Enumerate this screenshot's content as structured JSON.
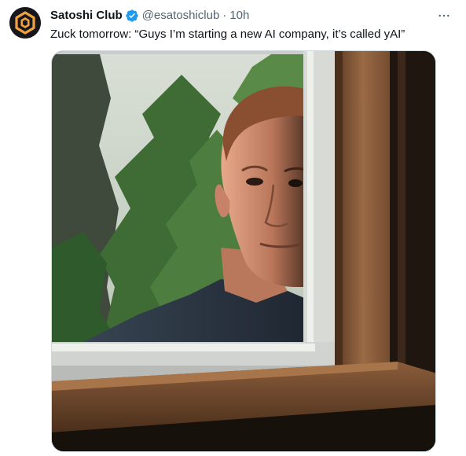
{
  "tweet": {
    "display_name": "Satoshi Club",
    "handle": "@esatoshiclub",
    "separator": "·",
    "time": "10h",
    "text": "Zuck tomorrow: “Guys I’m starting a new AI company, it’s called yAI”",
    "more_icon": "more-horizontal-icon",
    "verified_icon": "verified-badge-icon",
    "media_description_icon": "photo"
  },
  "colors": {
    "verified": "#1d9bf0",
    "secondary_text": "#536471",
    "primary_text": "#0f1419",
    "avatar_bg": "#16171c",
    "avatar_accent": "#f2a23a"
  }
}
